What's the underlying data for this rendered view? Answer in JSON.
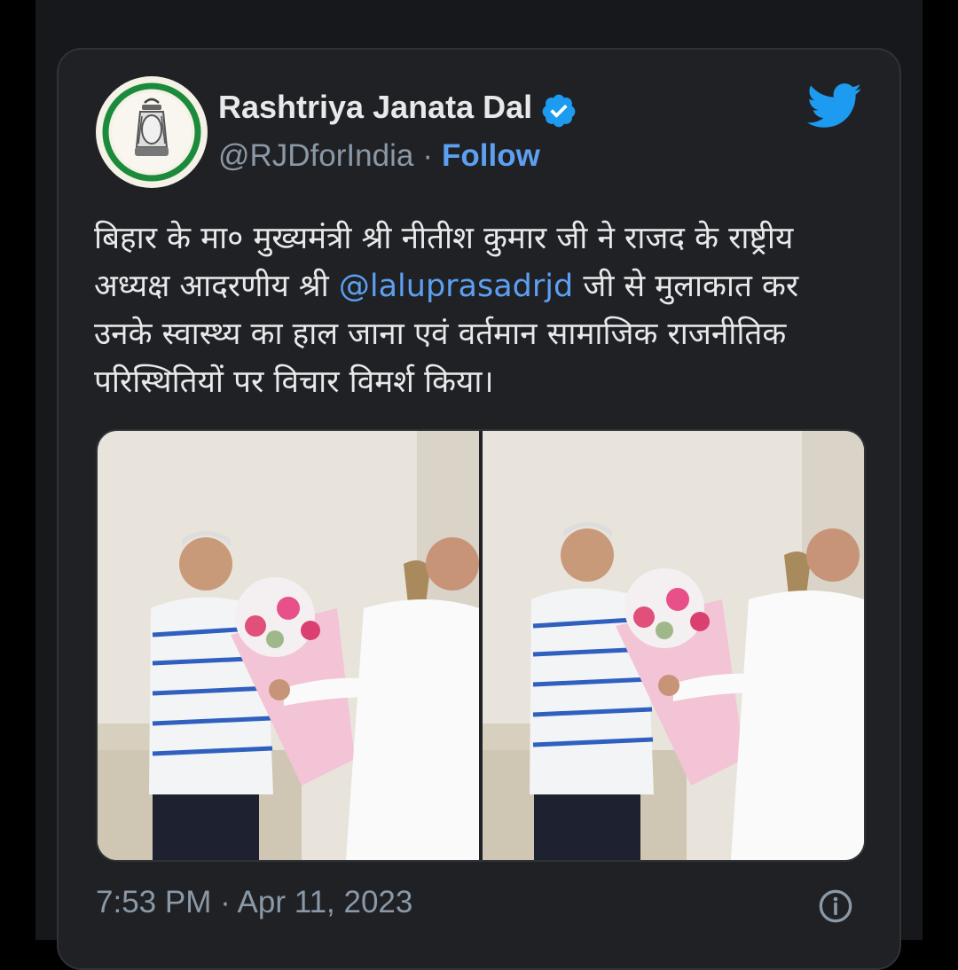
{
  "tweet": {
    "author": {
      "display_name": "Rashtriya Janata Dal",
      "handle": "@RJDforIndia",
      "verified": true,
      "avatar": "lantern-logo"
    },
    "follow_label": "Follow",
    "separator": "·",
    "text_before_mention": "बिहार के मा० मुख्यमंत्री श्री नीतीश कुमार जी ने राजद के राष्ट्रीय अध्यक्ष आदरणीय श्री ",
    "mention": "@laluprasadrjd",
    "text_after_mention": " जी से मुलाकात कर उनके स्वास्थ्य का हाल जाना एवं वर्तमान सामाजिक राजनीतिक परिस्थितियों पर विचार विमर्श किया।",
    "media": [
      {
        "description": "two men exchanging a flower bouquet"
      },
      {
        "description": "two men exchanging a flower bouquet"
      }
    ],
    "timestamp": "7:53 PM · Apr 11, 2023"
  },
  "icons": {
    "brand": "twitter-bird-icon",
    "verified": "verified-badge-icon",
    "info": "info-icon"
  },
  "colors": {
    "background": "#000000",
    "card": "#1f2125",
    "accent": "#5d9ff0",
    "twitter_blue": "#1d9bf0",
    "muted": "#8b98a5",
    "avatar_ring": "#1b8a3a"
  }
}
